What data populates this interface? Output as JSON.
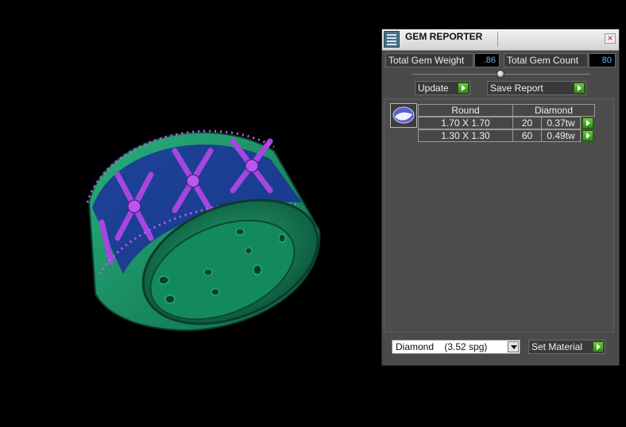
{
  "panel": {
    "title": "GEM REPORTER",
    "close_glyph": "×",
    "total_weight_label": "Total Gem Weight",
    "total_weight_value": ".86",
    "total_count_label": "Total Gem Count",
    "total_count_value": "80",
    "update_label": "Update",
    "save_report_label": "Save Report",
    "table": {
      "header": {
        "shape": "Round",
        "material": "Diamond"
      },
      "rows": [
        {
          "size": "1.70 X 1.70",
          "count": "20",
          "weight": "0.37tw"
        },
        {
          "size": "1.30 X 1.30",
          "count": "60",
          "weight": "0.49tw"
        }
      ]
    },
    "material_select": "Diamond    (3.52 spg)",
    "set_material_label": "Set Material"
  },
  "colors": {
    "ring_metal": "#1f9a6c",
    "ring_metal_dark": "#0c4f37",
    "gem_purple": "#9b3fd6",
    "gem_blue": "#2a3fcf",
    "accent_green": "#3aa51f"
  },
  "icons": {
    "app": "gem-reporter-icon",
    "close": "close-icon",
    "go": "green-arrow-icon",
    "dropdown": "chevron-down-icon"
  }
}
